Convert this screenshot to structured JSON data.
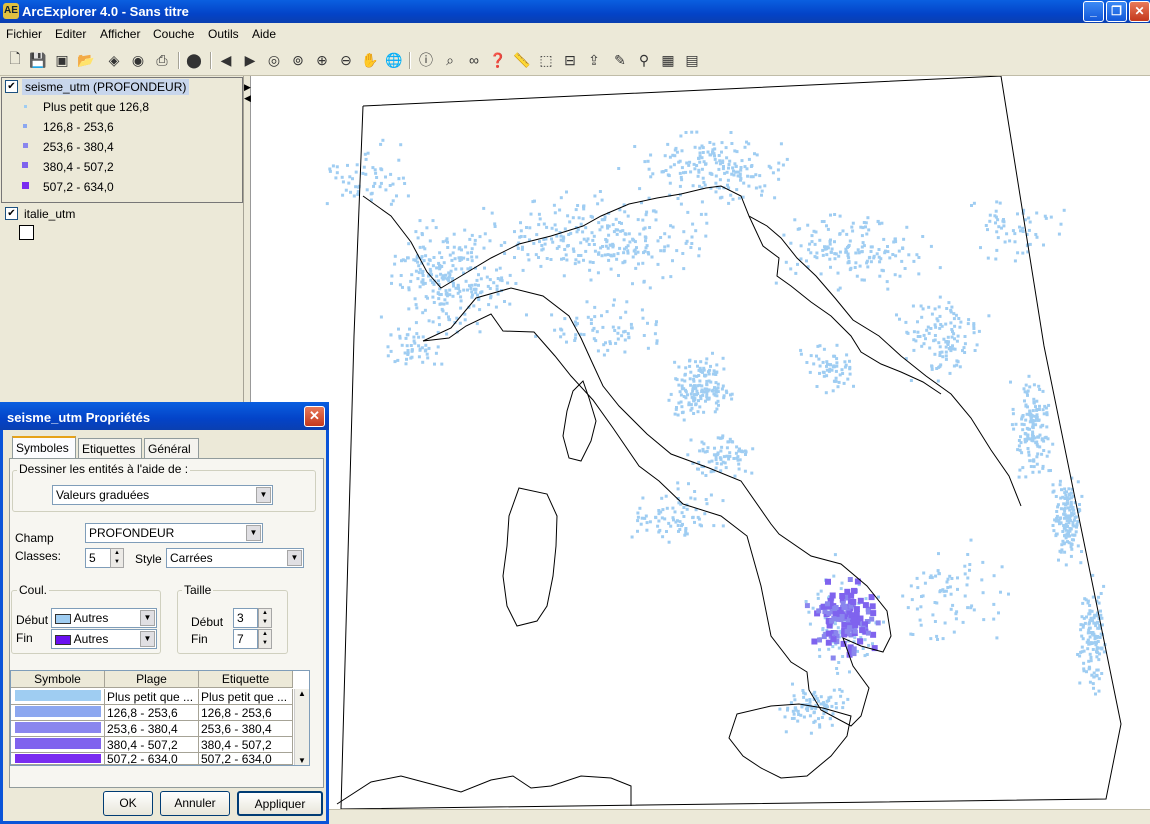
{
  "window": {
    "title": "ArcExplorer 4.0 - Sans titre",
    "app_icon_text": "AE",
    "min": "_",
    "restore": "❐",
    "close": "✕"
  },
  "menu": [
    "Fichier",
    "Editer",
    "Afficher",
    "Couche",
    "Outils",
    "Aide"
  ],
  "toolbar_icons": [
    "new-icon",
    "save-icon",
    "save-as-icon",
    "open-icon",
    "add-layer-icon",
    "remove-layer-icon",
    "print-icon",
    "stop-icon",
    "back-extent-icon",
    "forward-extent-icon",
    "zoom-layer-icon",
    "zoom-full-icon",
    "zoom-in-icon",
    "zoom-out-icon",
    "pan-icon",
    "globe-icon",
    "identify-icon",
    "find-icon",
    "binoculars-icon",
    "query-icon",
    "measure-icon",
    "select-icon",
    "clear-select-icon",
    "export-icon",
    "properties-icon",
    "eraser-icon",
    "search-map-icon",
    "grid-icon",
    "table-icon"
  ],
  "layers": [
    {
      "name": "seisme_utm (PROFONDEUR)",
      "checked": "✔",
      "classes": [
        "Plus petit que 126,8",
        "126,8 - 253,6",
        "253,6 - 380,4",
        "380,4 - 507,2",
        "507,2 - 634,0"
      ]
    },
    {
      "name": "italie_utm",
      "checked": "✔"
    }
  ],
  "dialog": {
    "title": "seisme_utm Propriétés",
    "close": "✕",
    "tabs": [
      "Symboles",
      "Etiquettes",
      "Général"
    ],
    "draw_group_label": "Dessiner les entités à l'aide de :",
    "draw_method": "Valeurs graduées",
    "champ_label": "Champ",
    "champ_value": "PROFONDEUR",
    "classes_label": "Classes:",
    "classes_value": "5",
    "style_label": "Style",
    "style_value": "Carrées",
    "couleur_label": "Coul.",
    "taille_label": "Taille",
    "debut_label": "Début",
    "fin_label": "Fin",
    "couleur_debut": "Autres",
    "couleur_fin": "Autres",
    "taille_debut": "3",
    "taille_fin": "7",
    "grid_headers": [
      "Symbole",
      "Plage",
      "Etiquette"
    ],
    "grid_rows": [
      {
        "plage": "Plus petit que ...",
        "etiquette": "Plus petit que ..."
      },
      {
        "plage": "126,8 - 253,6",
        "etiquette": "126,8 - 253,6"
      },
      {
        "plage": "253,6 - 380,4",
        "etiquette": "253,6 - 380,4"
      },
      {
        "plage": "380,4 - 507,2",
        "etiquette": "380,4 - 507,2"
      },
      {
        "plage": "507,2 - 634,0",
        "etiquette": "507,2 - 634,0"
      }
    ],
    "buttons": {
      "ok": "OK",
      "cancel": "Annuler",
      "apply": "Appliquer"
    }
  },
  "colors": {
    "class1": "#9fcdf2",
    "class2": "#8ca7f0",
    "class3": "#8a86ee",
    "class4": "#7f63ee",
    "class5": "#7a2cf0",
    "start_color": "#9fcdf2",
    "end_color": "#6a10f0"
  }
}
